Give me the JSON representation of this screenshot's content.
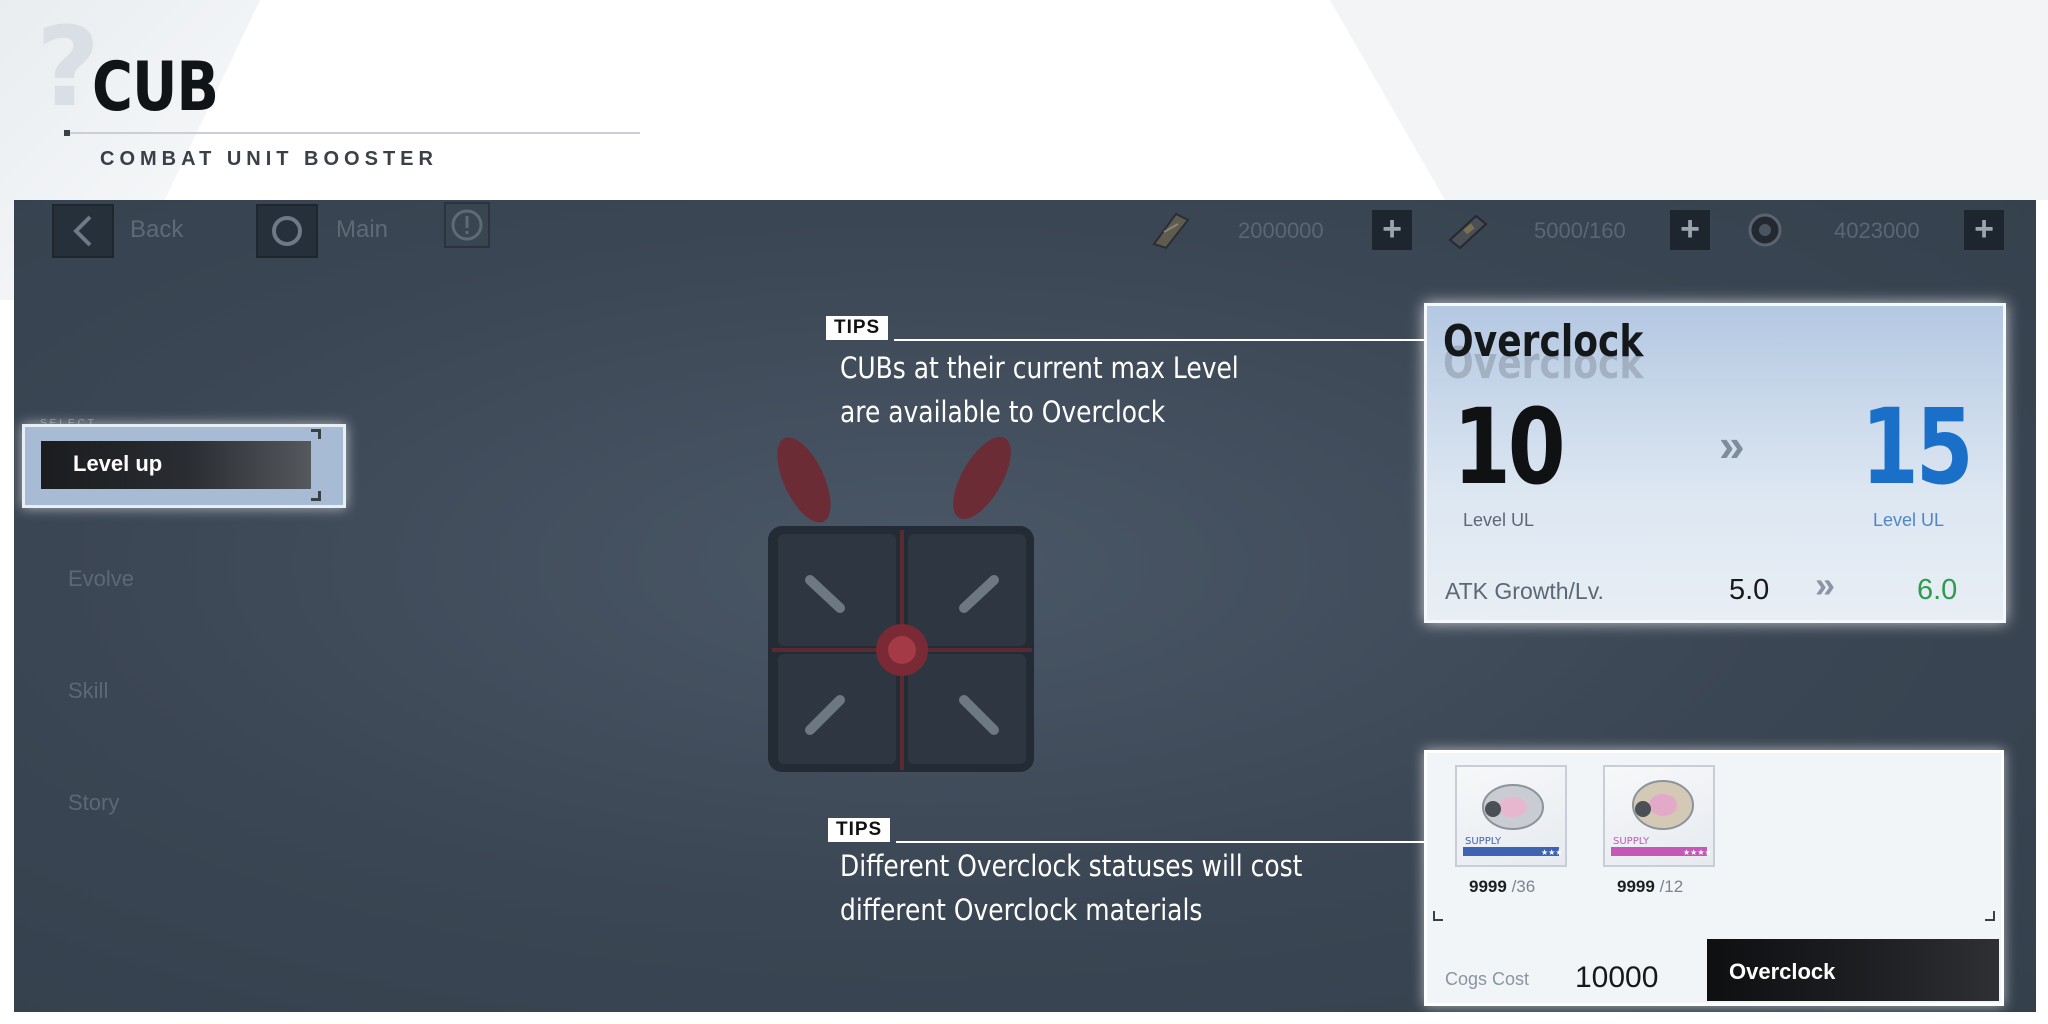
{
  "header": {
    "title": "CUB",
    "subtitle": "COMBAT UNIT BOOSTER"
  },
  "top_bar": {
    "back_label": "Back",
    "main_label": "Main",
    "resources": [
      {
        "icon": "ticket-icon",
        "value": "2000000"
      },
      {
        "icon": "battery-icon",
        "value": "5000/160"
      },
      {
        "icon": "cog-coin-icon",
        "value": "4023000"
      }
    ]
  },
  "side_menu": {
    "select_tag": "SELECT",
    "items": [
      {
        "label": "Level up",
        "selected": true
      },
      {
        "label": "Evolve",
        "selected": false
      },
      {
        "label": "Skill",
        "selected": false
      },
      {
        "label": "Story",
        "selected": false
      }
    ]
  },
  "tips": [
    {
      "tag": "TIPS",
      "lines": [
        "CUBs at their current max Level",
        "are available to Overclock"
      ]
    },
    {
      "tag": "TIPS",
      "lines": [
        "Different Overclock statuses will cost",
        "different Overclock materials"
      ]
    }
  ],
  "overclock": {
    "title": "Overclock",
    "level_from": "10",
    "level_to": "15",
    "level_label": "Level UL",
    "arrow": "»",
    "atk_label": "ATK Growth/Lv.",
    "atk_from": "5.0",
    "atk_to": "6.0",
    "colors": {
      "level_to": "#1a6fc9",
      "atk_to": "#2e9b4e"
    }
  },
  "materials": {
    "items": [
      {
        "icon": "supply-module-icon",
        "owned": "9999",
        "required": "/36",
        "badge": "SUPPLY"
      },
      {
        "icon": "supply-module-icon",
        "owned": "9999",
        "required": "/12",
        "badge": "SUPPLY"
      }
    ],
    "cogs_label": "Cogs Cost",
    "cogs_value": "10000",
    "button_label": "Overclock"
  }
}
